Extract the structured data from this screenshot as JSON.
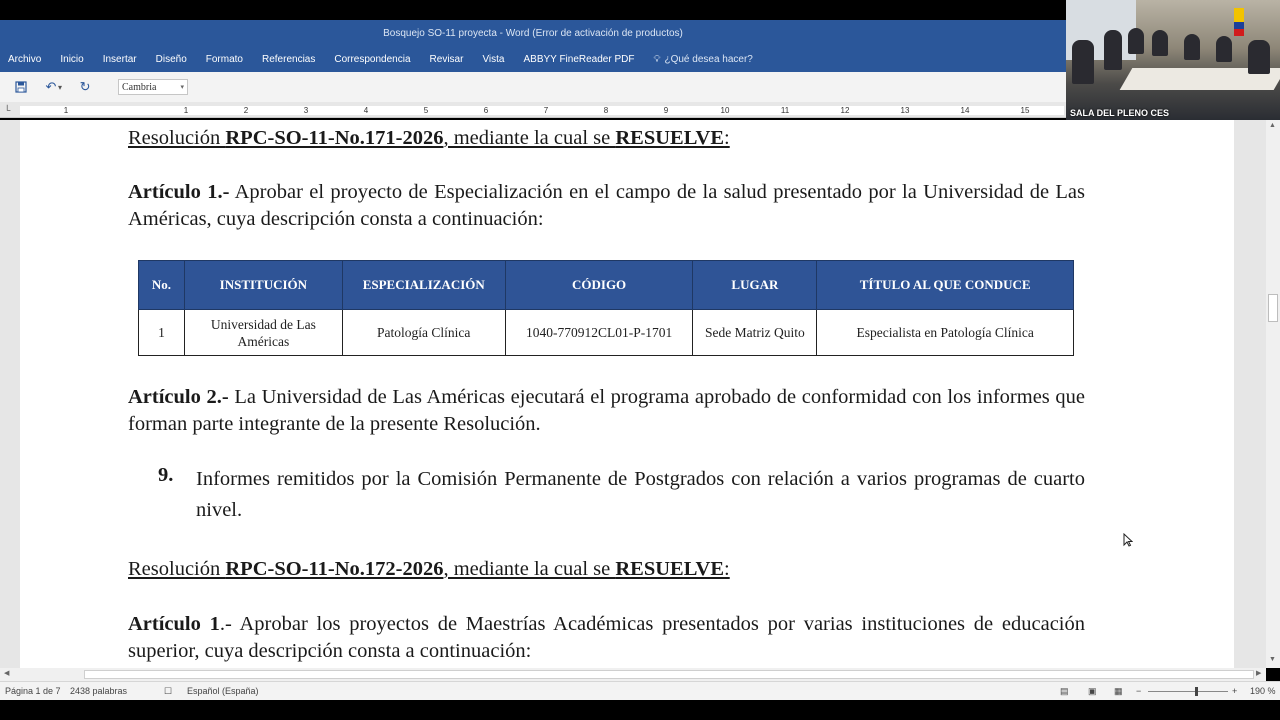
{
  "window": {
    "title": "Bosquejo SO-11 proyecta - Word (Error de activación de productos)"
  },
  "ribbon": {
    "tabs": [
      "Archivo",
      "Inicio",
      "Insertar",
      "Diseño",
      "Formato",
      "Referencias",
      "Correspondencia",
      "Revisar",
      "Vista",
      "ABBYY FineReader PDF"
    ],
    "tell_me": "¿Qué desea hacer?"
  },
  "qat": {
    "font_name": "Cambria"
  },
  "ruler": {
    "numbers": [
      "1",
      "1",
      "2",
      "3",
      "4",
      "5",
      "6",
      "7",
      "8",
      "9",
      "10",
      "11",
      "12",
      "13",
      "14",
      "15"
    ]
  },
  "webcam": {
    "label": "SALA DEL PLENO CES"
  },
  "doc": {
    "res1": {
      "pre": "Resolución ",
      "code": "RPC-SO-11-No.171-2026",
      "mid": ", mediante la cual se ",
      "verb": "RESUELVE",
      "post": ":"
    },
    "art1": {
      "label": "Artículo 1.-",
      "text": " Aprobar el proyecto de Especialización en el campo de la salud presentado por la Universidad de Las Américas, cuya descripción consta a continuación:"
    },
    "table": {
      "headers": [
        "No.",
        "INSTITUCIÓN",
        "ESPECIALIZACIÓN",
        "CÓDIGO",
        "LUGAR",
        "TÍTULO AL QUE CONDUCE"
      ],
      "rows": [
        [
          "1",
          "Universidad de Las Américas",
          "Patología Clínica",
          "1040-770912CL01-P-1701",
          "Sede Matriz Quito",
          "Especialista en Patología Clínica"
        ]
      ]
    },
    "art2": {
      "label": "Artículo 2.-",
      "text": " La Universidad de Las Américas ejecutará el programa aprobado de conformidad con los informes que forman parte integrante de la presente Resolución."
    },
    "item9": {
      "num": "9.",
      "text": "Informes remitidos por la Comisión Permanente de Postgrados con relación a varios programas de cuarto nivel."
    },
    "res2": {
      "pre": "Resolución ",
      "code": "RPC-SO-11-No.172-2026",
      "mid": ", mediante la cual se ",
      "verb": "RESUELVE",
      "post": ":"
    },
    "art1b": {
      "label": "Artículo 1",
      "text": ".- Aprobar los proyectos de Maestrías Académicas presentados por varias instituciones de educación superior, cuya descripción consta a continuación:"
    }
  },
  "status": {
    "page": "Página 1 de 7",
    "words": "2438 palabras",
    "language": "Español (España)",
    "zoom": "190 %"
  },
  "colors": {
    "ribbon": "#2b579a",
    "table_header": "#2f5496"
  }
}
